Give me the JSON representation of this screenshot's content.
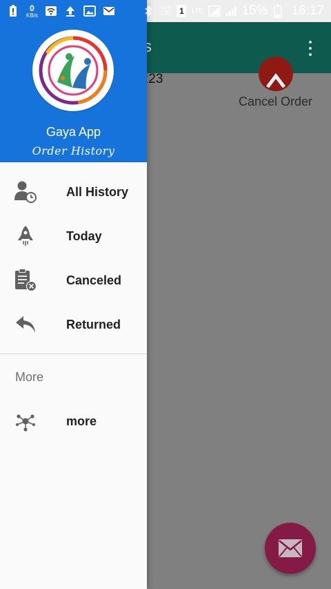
{
  "status_bar": {
    "left_icons": [
      "alert-battery-icon",
      "network-speed-icon",
      "wifi-icon",
      "upload-icon",
      "image-icon",
      "mail-icon"
    ],
    "network_speed_value": "0",
    "network_speed_unit": "KB/s",
    "right_icons": [
      "bluetooth-icon",
      "volte-icon",
      "sim-1-icon",
      "lte-icon",
      "signal-icon",
      "battery-icon"
    ],
    "volte_label": "Vo)) LTE",
    "sim_label": "1",
    "lte_label": "LTE",
    "battery_percent": "15%",
    "time": "16:17"
  },
  "background_app": {
    "title_fragment": "s",
    "order_time_fragment": ":23",
    "cancel_button_label": "Cancel Order",
    "fab_icon": "email-icon",
    "toolbar_color": "#0e5a4e",
    "fab_color": "#841b47"
  },
  "drawer": {
    "header_color": "#1773dc",
    "app_name": "Gaya App",
    "subtitle": "Order History",
    "items": [
      {
        "label": "All History",
        "icon": "user-clock-icon"
      },
      {
        "label": "Today",
        "icon": "rocket-icon"
      },
      {
        "label": "Canceled",
        "icon": "clipboard-cancel-icon"
      },
      {
        "label": "Returned",
        "icon": "reply-icon"
      }
    ],
    "section_title": "More",
    "more_items": [
      {
        "label": "more",
        "icon": "share-nodes-icon"
      }
    ]
  }
}
